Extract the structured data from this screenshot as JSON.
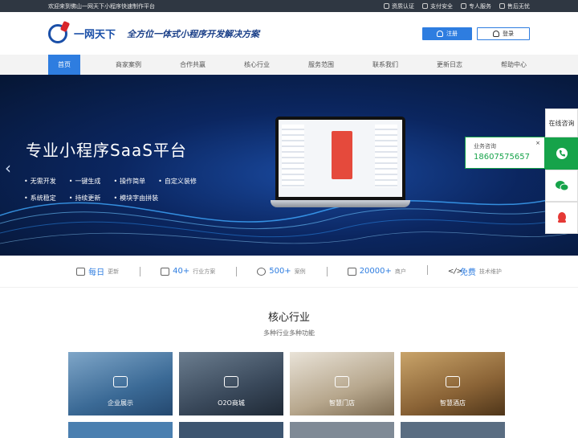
{
  "topbar": {
    "welcome": "欢迎来到佛山一网天下小程序快速制作平台",
    "links": [
      {
        "icon": "certified-icon",
        "label": "资质认证"
      },
      {
        "icon": "shield-icon",
        "label": "支付安全"
      },
      {
        "icon": "service-icon",
        "label": "专人服务"
      },
      {
        "icon": "thumb-icon",
        "label": "售后无忧"
      }
    ]
  },
  "header": {
    "logo_name": "一网天下",
    "slogan": "全方位一体式小程序开发解决方案",
    "register": "注册",
    "login": "登录"
  },
  "nav": [
    "首页",
    "商家案例",
    "合作共赢",
    "核心行业",
    "服务范围",
    "联系我们",
    "更新日志",
    "帮助中心"
  ],
  "banner": {
    "title": "专业小程序SaaS平台",
    "features_row1": [
      "无需开发",
      "一键生成",
      "操作简单",
      "自定义装修"
    ],
    "features_row2": [
      "系统稳定",
      "持续更新",
      "模块字由拼装"
    ]
  },
  "stats": [
    {
      "num": "每日",
      "label": "更新"
    },
    {
      "num": "40+",
      "label": "行业方案"
    },
    {
      "num": "500+",
      "label": "案例"
    },
    {
      "num": "20000+",
      "label": "商户"
    },
    {
      "num": "免费",
      "label": "技术维护"
    }
  ],
  "section": {
    "title": "核心行业",
    "subtitle": "多种行业多种功能"
  },
  "cards": [
    {
      "label": "企业展示"
    },
    {
      "label": "O2O商城"
    },
    {
      "label": "智慧门店"
    },
    {
      "label": "智慧酒店"
    }
  ],
  "side": {
    "online": "在线咨询",
    "popup_label": "业务咨询",
    "phone": "18607575657",
    "close": "×"
  },
  "colors": {
    "accent": "#2e7de0",
    "side_green": "#16a34a",
    "banner_dark": "#0b2660"
  }
}
